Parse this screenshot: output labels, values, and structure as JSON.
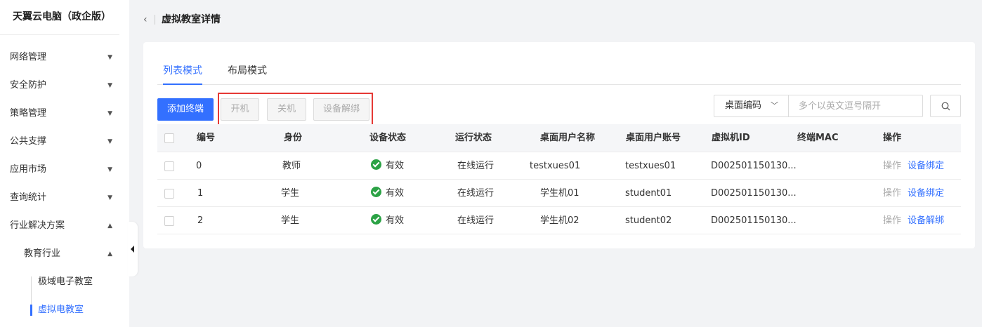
{
  "brand": "天翼云电脑（政企版）",
  "sidebar": {
    "items": [
      {
        "label": "网络管理",
        "arrow": "▼"
      },
      {
        "label": "安全防护",
        "arrow": "▼"
      },
      {
        "label": "策略管理",
        "arrow": "▼"
      },
      {
        "label": "公共支撑",
        "arrow": "▼"
      },
      {
        "label": "应用市场",
        "arrow": "▼"
      },
      {
        "label": "查询统计",
        "arrow": "▼"
      },
      {
        "label": "行业解决方案",
        "arrow": "▲"
      }
    ],
    "sub_item": {
      "label": "教育行业",
      "arrow": "▲"
    },
    "leaves": [
      {
        "label": "极域电子教室",
        "active": false
      },
      {
        "label": "虚拟电教室",
        "active": true
      }
    ]
  },
  "header": {
    "back_icon": "‹",
    "title": "虚拟教室详情"
  },
  "tabs": [
    {
      "label": "列表模式",
      "active": true
    },
    {
      "label": "布局模式",
      "active": false
    }
  ],
  "toolbar": {
    "add_label": "添加终端",
    "power_on_label": "开机",
    "power_off_label": "关机",
    "unbind_label": "设备解绑"
  },
  "search": {
    "select_label": "桌面编码",
    "chevron": "﹀",
    "placeholder": "多个以英文逗号隔开",
    "value": ""
  },
  "table": {
    "columns": [
      "编号",
      "身份",
      "设备状态",
      "运行状态",
      "桌面用户名称",
      "桌面用户账号",
      "虚拟机ID",
      "终端MAC",
      "操作"
    ],
    "rows": [
      {
        "id": "0",
        "role": "教师",
        "device_status": "有效",
        "run_status": "在线运行",
        "user_name": "testxues01",
        "user_account": "testxues01",
        "vm_id": "D002501150130...",
        "mac": "",
        "op1": "操作",
        "op2": "设备绑定"
      },
      {
        "id": "1",
        "role": "学生",
        "device_status": "有效",
        "run_status": "在线运行",
        "user_name": "学生机01",
        "user_account": "student01",
        "vm_id": "D002501150130...",
        "mac": "",
        "op1": "操作",
        "op2": "设备绑定"
      },
      {
        "id": "2",
        "role": "学生",
        "device_status": "有效",
        "run_status": "在线运行",
        "user_name": "学生机02",
        "user_account": "student02",
        "vm_id": "D002501150130...",
        "mac": "",
        "op1": "操作",
        "op2": "设备解绑"
      }
    ]
  },
  "colors": {
    "accent": "#3370ff",
    "success": "#2ba245",
    "highlight": "#e53935"
  }
}
